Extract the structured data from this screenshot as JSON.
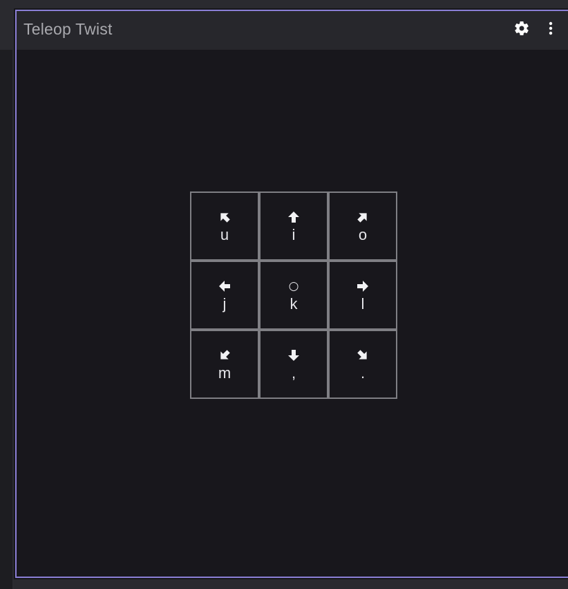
{
  "panel": {
    "title": "Teleop Twist",
    "settings_icon": "gear-icon",
    "menu_icon": "more-vertical-icon",
    "accent_color": "#8b7fd6"
  },
  "keypad": {
    "keys": [
      {
        "label": "u",
        "icon": "arrow-up-left-icon"
      },
      {
        "label": "i",
        "icon": "arrow-up-icon"
      },
      {
        "label": "o",
        "icon": "arrow-up-right-icon"
      },
      {
        "label": "j",
        "icon": "arrow-left-icon"
      },
      {
        "label": "k",
        "icon": "stop-circle-icon",
        "glyph": "○"
      },
      {
        "label": "l",
        "icon": "arrow-right-icon"
      },
      {
        "label": "m",
        "icon": "arrow-down-left-icon"
      },
      {
        "label": ",",
        "icon": "arrow-down-icon"
      },
      {
        "label": ".",
        "icon": "arrow-down-right-icon"
      }
    ]
  }
}
